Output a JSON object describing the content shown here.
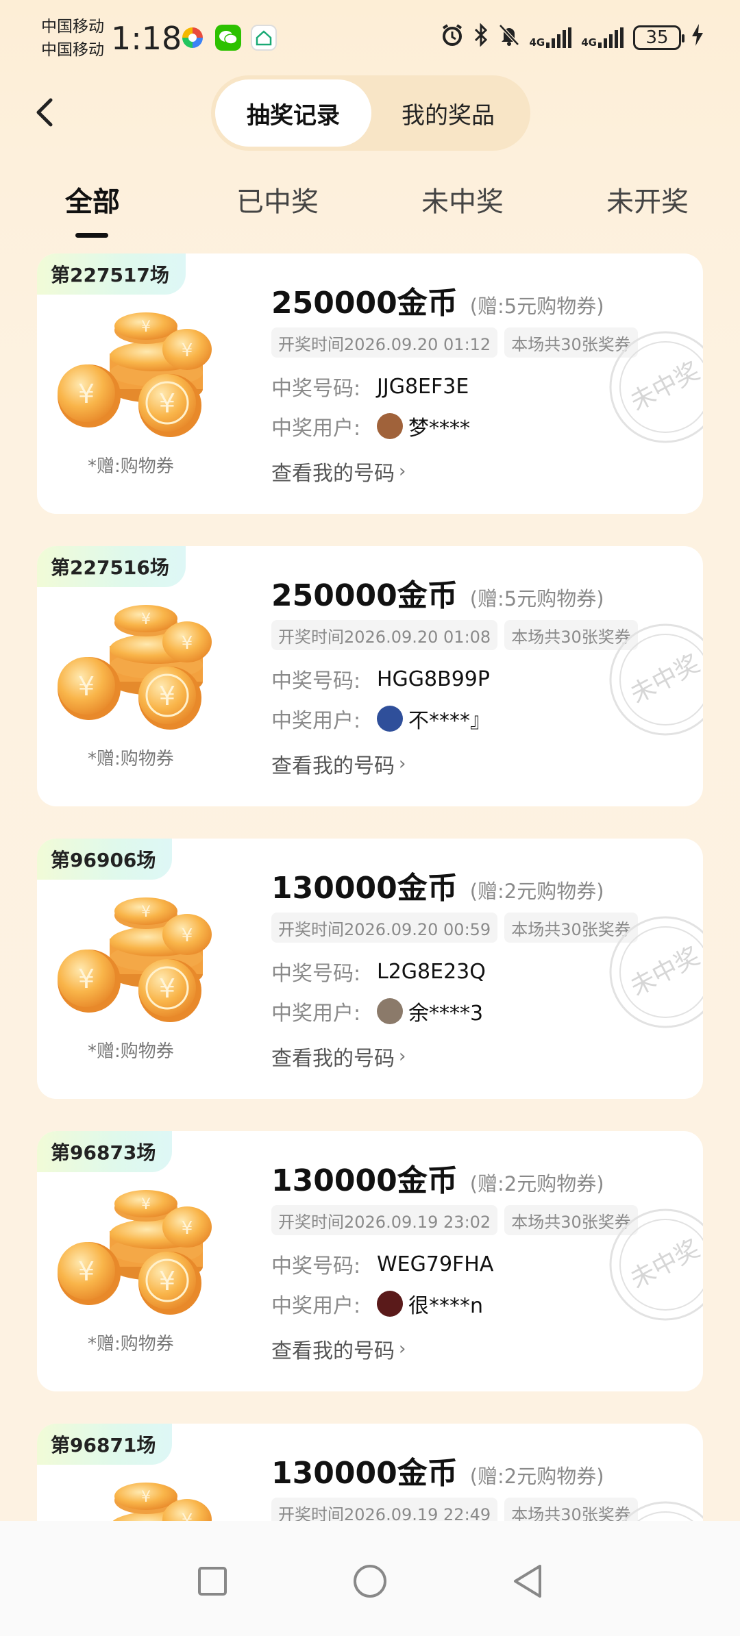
{
  "status_bar": {
    "carrier_1": "中国移动",
    "carrier_2": "中国移动",
    "time": "1:18",
    "network_1": "4G",
    "network_2": "4G",
    "battery": "35"
  },
  "header": {
    "segment_active": "抽奖记录",
    "segment_inactive": "我的奖品"
  },
  "tabs": [
    "全部",
    "已中奖",
    "未中奖",
    "未开奖"
  ],
  "labels": {
    "winning_number": "中奖号码:",
    "winning_user": "中奖用户:",
    "my_codes": "查看我的号码",
    "coin_note": "*赠:购物券",
    "stamp": "未中奖"
  },
  "records": [
    {
      "round": "第227517场",
      "amount": "250000金币",
      "bonus": "(赠:5元购物券)",
      "draw_time": "开奖时间2026.09.20 01:12",
      "tickets": "本场共30张奖券",
      "code": "JJG8EF3E",
      "user": "梦****",
      "avatar_color": "#a0623a"
    },
    {
      "round": "第227516场",
      "amount": "250000金币",
      "bonus": "(赠:5元购物券)",
      "draw_time": "开奖时间2026.09.20 01:08",
      "tickets": "本场共30张奖券",
      "code": "HGG8B99P",
      "user": "不****』",
      "avatar_color": "#2f4f9a"
    },
    {
      "round": "第96906场",
      "amount": "130000金币",
      "bonus": "(赠:2元购物券)",
      "draw_time": "开奖时间2026.09.20 00:59",
      "tickets": "本场共30张奖券",
      "code": "L2G8E23Q",
      "user": "余****3",
      "avatar_color": "#8b7a6a"
    },
    {
      "round": "第96873场",
      "amount": "130000金币",
      "bonus": "(赠:2元购物券)",
      "draw_time": "开奖时间2026.09.19 23:02",
      "tickets": "本场共30张奖券",
      "code": "WEG79FHA",
      "user": "很****n",
      "avatar_color": "#5a1a1a"
    },
    {
      "round": "第96871场",
      "amount": "130000金币",
      "bonus": "(赠:2元购物券)",
      "draw_time": "开奖时间2026.09.19 22:49",
      "tickets": "本场共30张奖券",
      "code": "",
      "user": "",
      "avatar_color": "#cccccc"
    }
  ],
  "colors": {
    "background": "#fdf0dc",
    "coin": "#f5a83a",
    "stamp": "#d9d9d9"
  }
}
